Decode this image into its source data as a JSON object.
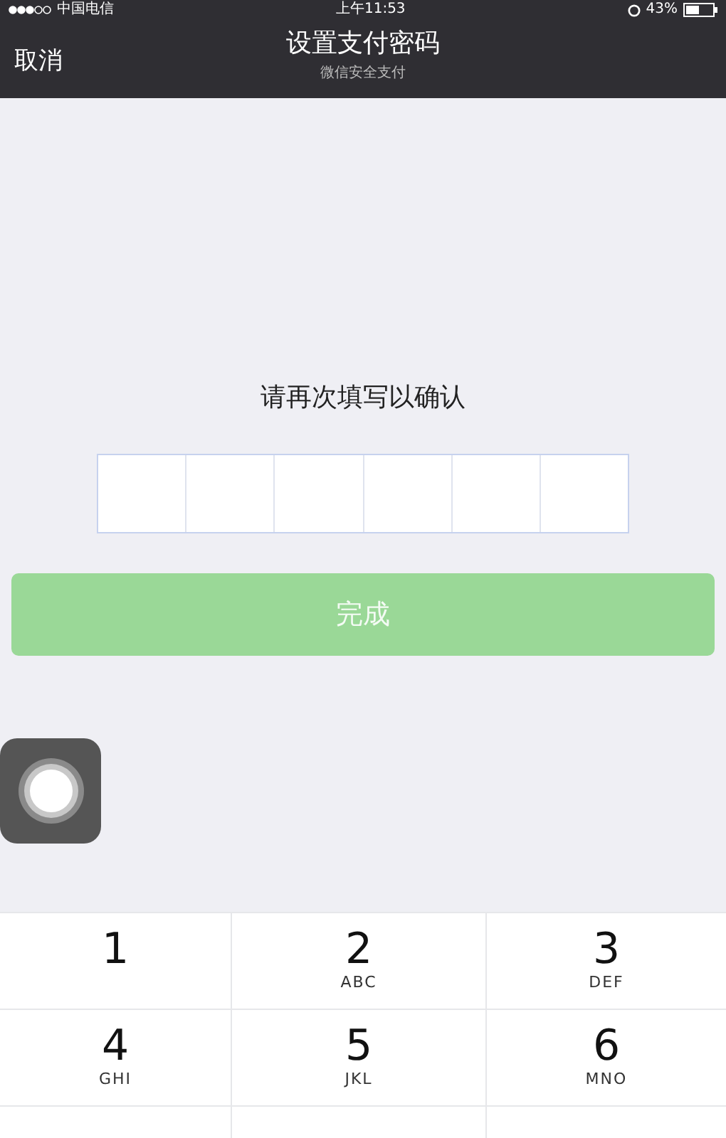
{
  "status_bar": {
    "carrier": "中国电信",
    "time": "上午11:53",
    "battery": "43%"
  },
  "nav": {
    "cancel": "取消",
    "title": "设置支付密码",
    "subtitle": "微信安全支付"
  },
  "prompt": "请再次填写以确认",
  "done_button": {
    "label": "完成",
    "disabled": true
  },
  "keypad": [
    {
      "digit": "1"
    },
    {
      "digit": "2",
      "letters": "ABC"
    },
    {
      "digit": "3",
      "letters": "DEF"
    },
    {
      "digit": "4",
      "letters": "GHI"
    },
    {
      "digit": "5",
      "letters": "JKL"
    },
    {
      "digit": "6",
      "letters": "MNO"
    }
  ]
}
